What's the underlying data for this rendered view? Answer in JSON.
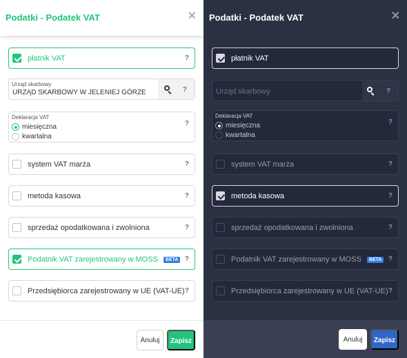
{
  "light": {
    "title": "Podatki - Podatek VAT",
    "vat_payer": {
      "label": "płatnik VAT",
      "checked": true,
      "help": "?"
    },
    "tax_office": {
      "label": "Urząd skarbowy",
      "value": "URZĄD SKARBOWY W JELENIEJ GÓRZE",
      "help": "?"
    },
    "declaration": {
      "label": "Deklaracja VAT",
      "options": [
        {
          "label": "miesięczna",
          "selected": true
        },
        {
          "label": "kwartalna",
          "selected": false
        }
      ],
      "help": "?"
    },
    "rows": [
      {
        "label": "system VAT marża",
        "checked": false,
        "help": "?"
      },
      {
        "label": "metoda kasowa",
        "checked": false,
        "help": "?"
      },
      {
        "label": "sprzedaż opodatkowana i zwolniona",
        "checked": false,
        "help": "?"
      },
      {
        "label": "Podatnik VAT zarejestrowany w MOSS",
        "checked": true,
        "badge": "BETA",
        "help": "?"
      },
      {
        "label": "Przedsiębiorca zarejestrowany w UE (VAT-UE)",
        "checked": false,
        "help": "?"
      }
    ],
    "cancel_label": "Anuluj",
    "save_label": "Zapisz"
  },
  "dark": {
    "title": "Podatki - Podatek VAT",
    "vat_payer": {
      "label": "płatnik VAT",
      "checked": true,
      "help": "?"
    },
    "tax_office": {
      "placeholder": "Urząd skarbowy",
      "help": "?"
    },
    "declaration": {
      "label": "Deklaracja VAT",
      "options": [
        {
          "label": "miesięczna",
          "selected": true
        },
        {
          "label": "kwartalna",
          "selected": false
        }
      ],
      "help": "?"
    },
    "rows": [
      {
        "label": "system VAT marża",
        "checked": false,
        "help": "?"
      },
      {
        "label": "metoda kasowa",
        "checked": true,
        "help": "?"
      },
      {
        "label": "sprzedaż opodatkowana i zwolniona",
        "checked": false,
        "help": "?"
      },
      {
        "label": "Podatnik VAT zarejestrowany w MOSS",
        "checked": false,
        "badge": "BETA",
        "help": "?"
      },
      {
        "label": "Przedsiębiorca zarejestrowany w UE (VAT-UE)",
        "checked": false,
        "help": "?"
      }
    ],
    "cancel_label": "Anuluj",
    "save_label": "Zapisz"
  },
  "close_glyph": "✕",
  "colors": {
    "light_accent": "#22c47d",
    "dark_background": "#2b3043",
    "dark_save": "#2f66c8",
    "badge": "#2f7de1"
  }
}
